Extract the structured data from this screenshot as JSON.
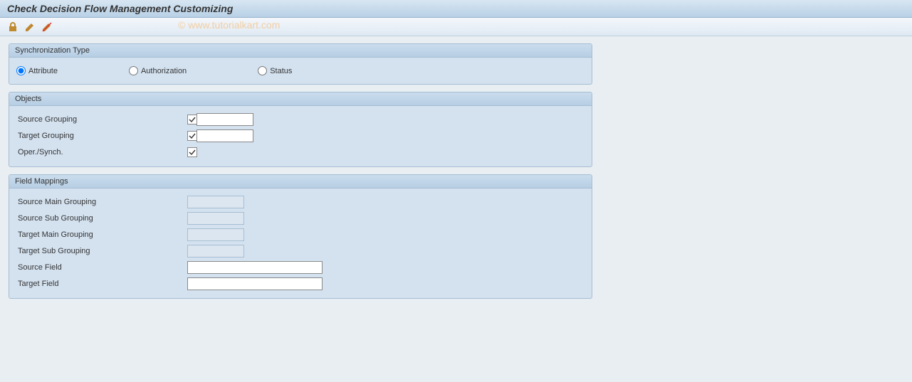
{
  "title": "Check Decision Flow Management Customizing",
  "watermark": "© www.tutorialkart.com",
  "toolbar": {
    "icons": [
      "lock-icon",
      "pencil-icon",
      "pencil-slash-icon"
    ]
  },
  "groups": {
    "sync": {
      "title": "Synchronization Type",
      "options": {
        "attribute": "Attribute",
        "authorization": "Authorization",
        "status": "Status"
      },
      "selected": "attribute"
    },
    "objects": {
      "title": "Objects",
      "rows": {
        "source_grouping": {
          "label": "Source Grouping",
          "checked": true,
          "value": ""
        },
        "target_grouping": {
          "label": "Target Grouping",
          "checked": true,
          "value": ""
        },
        "oper_synch": {
          "label": "Oper./Synch.",
          "checked": true
        }
      }
    },
    "mappings": {
      "title": "Field Mappings",
      "rows": {
        "source_main": {
          "label": "Source Main Grouping",
          "value": ""
        },
        "source_sub": {
          "label": "Source Sub Grouping",
          "value": ""
        },
        "target_main": {
          "label": "Target Main Grouping",
          "value": ""
        },
        "target_sub": {
          "label": "Target Sub Grouping",
          "value": ""
        },
        "source_field": {
          "label": "Source Field",
          "value": ""
        },
        "target_field": {
          "label": "Target Field",
          "value": ""
        }
      }
    }
  }
}
